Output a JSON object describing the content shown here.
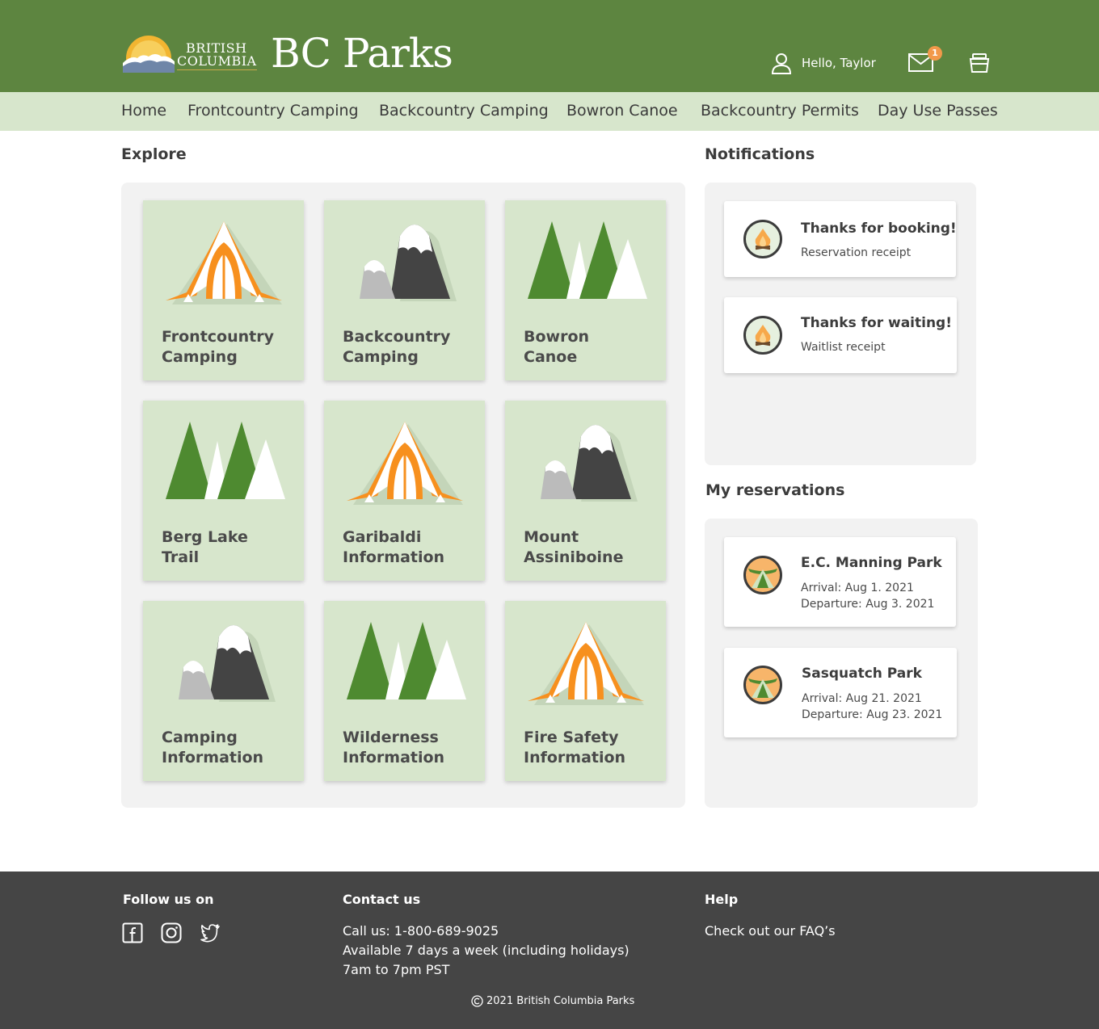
{
  "header": {
    "logo_line1": "BRITISH",
    "logo_line2": "COLUMBIA",
    "site_title": "BC Parks",
    "greeting": "Hello, Taylor",
    "mail_badge": "1"
  },
  "nav": [
    {
      "label": "Home"
    },
    {
      "label": "Frontcountry Camping"
    },
    {
      "label": "Backcountry Camping"
    },
    {
      "label": "Bowron Canoe"
    },
    {
      "label": "Backcountry Permits"
    },
    {
      "label": "Day Use Passes"
    }
  ],
  "explore": {
    "title": "Explore",
    "tiles": [
      {
        "line1": "Frontcountry",
        "line2": "Camping",
        "icon": "tent-icon"
      },
      {
        "line1": "Backcountry",
        "line2": "Camping",
        "icon": "mountain-icon"
      },
      {
        "line1": "Bowron",
        "line2": "Canoe",
        "icon": "trees-icon"
      },
      {
        "line1": "Berg Lake",
        "line2": "Trail",
        "icon": "trees-icon"
      },
      {
        "line1": "Garibaldi",
        "line2": "Information",
        "icon": "tent-icon"
      },
      {
        "line1": "Mount",
        "line2": "Assiniboine",
        "icon": "mountain-icon"
      },
      {
        "line1": "Camping",
        "line2": "Information",
        "icon": "mountain-icon"
      },
      {
        "line1": "Wilderness",
        "line2": "Information",
        "icon": "trees-icon"
      },
      {
        "line1": "Fire Safety",
        "line2": "Information",
        "icon": "tent-icon"
      }
    ]
  },
  "notifications": {
    "title": "Notifications",
    "items": [
      {
        "title": "Thanks for booking!",
        "subtitle": "Reservation receipt",
        "icon": "campfire-icon"
      },
      {
        "title": "Thanks for waiting!",
        "subtitle": "Waitlist receipt",
        "icon": "campfire-icon"
      }
    ]
  },
  "reservations": {
    "title": "My reservations",
    "items": [
      {
        "park": "E.C. Manning Park",
        "arrival": "Arrival: Aug 1. 2021",
        "departure": "Departure: Aug 3. 2021",
        "icon": "tent-badge-icon"
      },
      {
        "park": "Sasquatch Park",
        "arrival": "Arrival: Aug 21. 2021",
        "departure": "Departure: Aug 23. 2021",
        "icon": "tent-badge-icon"
      }
    ]
  },
  "footer": {
    "follow_title": "Follow us on",
    "social": [
      "facebook-icon",
      "instagram-icon",
      "twitter-icon"
    ],
    "contact_title": "Contact us",
    "contact_lines": [
      "Call us: 1-800-689-9025",
      "Available 7 days a week (including holidays)",
      "7am to 7pm PST"
    ],
    "help_title": "Help",
    "help_link": "Check out our FAQ’s",
    "copyright": "2021 British Columbia Parks"
  },
  "colors": {
    "header_green": "#5d8540",
    "nav_bg": "#d7e6cc",
    "tile_bg": "#d7e6cc",
    "panel_bg": "#f2f2f2",
    "accent_orange": "#f7901e",
    "tree_green": "#4e8a30",
    "footer_bg": "#454545"
  }
}
